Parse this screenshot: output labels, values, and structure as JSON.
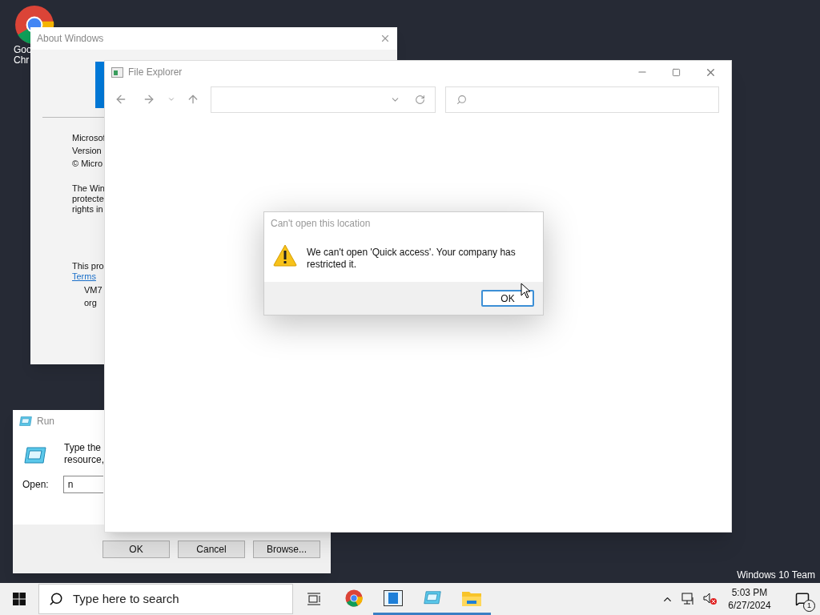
{
  "desktop": {
    "icon": {
      "label_lines": [
        "Goo",
        "Chr"
      ]
    },
    "edition_label": "Windows 10 Team"
  },
  "about_window": {
    "title": "About Windows",
    "lines_1": [
      "Microsof",
      "Version",
      "© Micro"
    ],
    "lines_2": [
      "The Win",
      "protecte",
      "rights in"
    ],
    "line_3": "This pro",
    "link": "Terms",
    "lines_4": [
      "VM7",
      "org"
    ]
  },
  "file_explorer": {
    "title": "File Explorer"
  },
  "dialog": {
    "title": "Can't open this location",
    "message": "We can't open 'Quick access'. Your company has restricted it.",
    "button": "OK"
  },
  "run_window": {
    "title": "Run",
    "description_lines": [
      "Type the",
      "resource,"
    ],
    "open_label": "Open:",
    "open_value": "n",
    "buttons": [
      "OK",
      "Cancel",
      "Browse..."
    ]
  },
  "taskbar": {
    "search_placeholder": "Type here to search",
    "apps": [
      {
        "kind": "chrome",
        "running": false
      },
      {
        "kind": "window",
        "running": true
      },
      {
        "kind": "run",
        "running": true
      },
      {
        "kind": "folder",
        "running": true
      }
    ],
    "time": "5:03 PM",
    "date": "6/27/2024",
    "notification_count": "1"
  }
}
